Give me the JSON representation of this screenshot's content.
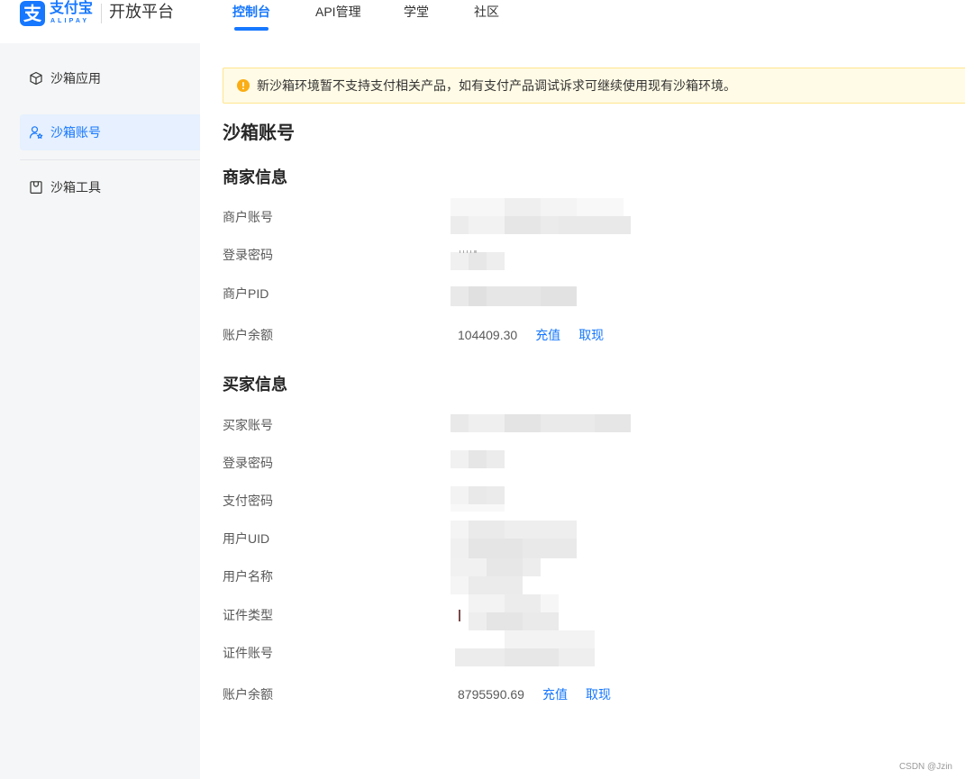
{
  "logo": {
    "mark": "支",
    "name": "支付宝",
    "name_en": "ALIPAY",
    "product": "开放平台"
  },
  "nav": {
    "items": [
      {
        "label": "控制台",
        "active": true
      },
      {
        "label": "API管理",
        "active": false
      },
      {
        "label": "学堂",
        "active": false
      },
      {
        "label": "社区",
        "active": false
      }
    ]
  },
  "sidebar": {
    "items": [
      {
        "label": "沙箱应用",
        "icon": "cube-icon",
        "active": false
      },
      {
        "label": "沙箱账号",
        "icon": "user-icon",
        "active": true
      },
      {
        "label": "沙箱工具",
        "icon": "toolbag-icon",
        "active": false
      }
    ]
  },
  "notice": {
    "icon": "warning-circle-icon",
    "text": "新沙箱环境暂不支持支付相关产品，如有支付产品调试诉求可继续使用现有沙箱环境。"
  },
  "page": {
    "title": "沙箱账号"
  },
  "merchant": {
    "heading": "商家信息",
    "rows": [
      {
        "label": "商户账号",
        "redacted": true
      },
      {
        "label": "登录密码",
        "redacted": true
      },
      {
        "label": "商户PID",
        "redacted": true
      },
      {
        "label": "账户余额",
        "value": "104409.30",
        "actions": [
          "充值",
          "取现"
        ]
      }
    ]
  },
  "buyer": {
    "heading": "买家信息",
    "rows": [
      {
        "label": "买家账号",
        "redacted": true
      },
      {
        "label": "登录密码",
        "redacted": true
      },
      {
        "label": "支付密码",
        "redacted": true
      },
      {
        "label": "用户UID",
        "redacted": true
      },
      {
        "label": "用户名称",
        "redacted": true
      },
      {
        "label": "证件类型",
        "redacted": true
      },
      {
        "label": "证件账号",
        "redacted": true
      },
      {
        "label": "账户余额",
        "value": "8795590.69",
        "actions": [
          "充值",
          "取现"
        ]
      }
    ]
  },
  "colors": {
    "accent": "#1677ff",
    "notice_bg": "#fffbe6",
    "notice_border": "#ffe58f",
    "warning": "#faad14",
    "active_bg": "#e6f0fe"
  },
  "watermark": "CSDN @Jzin"
}
